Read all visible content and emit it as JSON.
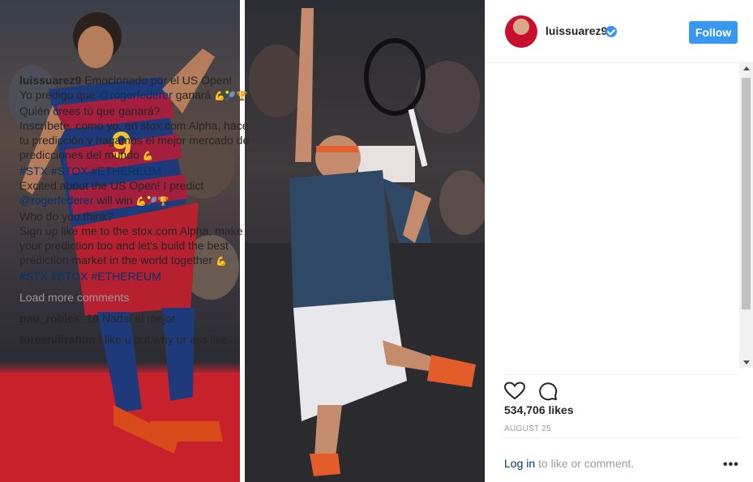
{
  "post": {
    "username": "luissuarez9",
    "follow_label": "Follow",
    "caption": {
      "user": "luissuarez9",
      "line1": "Emocionado por el US Open!",
      "line2a": "Yo predigo que ",
      "mention1": "@rogerfederer",
      "line2b": " ganará ",
      "emoji_es1": "💪🎾🏆",
      "line3": "Quién crees tú que ganará?",
      "line4": "Inscríbete, como yo, en stox.com Alpha, hacé tu predicción y hagamos el mejor mercado de predicciones del mundo ",
      "emoji_es2": "💪",
      "tags1": "#STX #STOX #ETHEREUM",
      "line5": "Excited about the US Open! I predict",
      "mention2": "@rogerfederer",
      "line6": " will win ",
      "emoji_en1": "💪🎾🏆",
      "line7": "Who do you think?",
      "line8": "Sign up like me to the stox.com Alpha, make your prediction too and let's build the best prediction market in the world together ",
      "emoji_en2": "💪",
      "tags2": "#STX #STOX #ETHEREUM"
    },
    "load_more": "Load more comments",
    "comments": [
      {
        "user": "pau_robles_10",
        "text": "Nadal el mejor"
      },
      {
        "user": "tureenibrahim",
        "text": "I like u but why ur ass like"
      }
    ],
    "likes": "534,706 likes",
    "date": "AUGUST 25",
    "footer": {
      "login": "Log in",
      "rest": " to like or comment."
    }
  },
  "icons": {
    "heart": "heart-icon",
    "comment": "comment-icon",
    "more": "more-options-icon",
    "verified": "verified-badge-icon"
  },
  "colors": {
    "accent": "#3897f0",
    "link": "#003569",
    "muted": "#999999"
  }
}
